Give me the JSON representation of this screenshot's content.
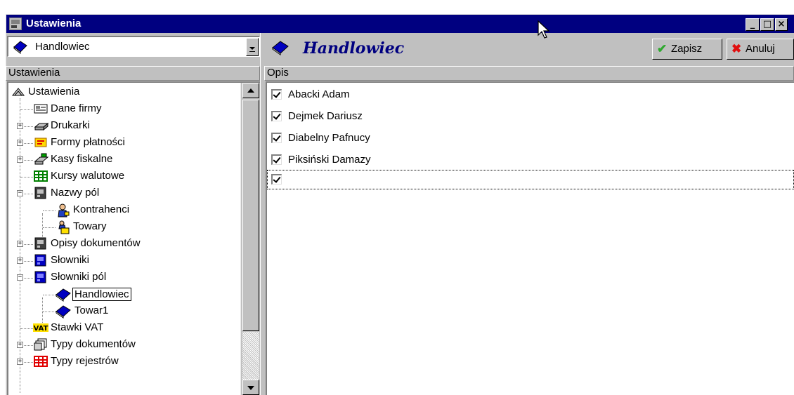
{
  "window": {
    "title": "Ustawienia",
    "minimize": "_",
    "maximize": "□",
    "close": "×"
  },
  "left_panel": {
    "combo_value": "Handlowiec",
    "column_header": "Ustawienia",
    "tree": [
      {
        "label": "Ustawienia",
        "icon": "settings-root-icon",
        "level": 0,
        "expander": ""
      },
      {
        "label": "Dane firmy",
        "icon": "company-card-icon",
        "level": 1,
        "expander": ""
      },
      {
        "label": "Drukarki",
        "icon": "printer-icon",
        "level": 1,
        "expander": "+"
      },
      {
        "label": "Formy płatności",
        "icon": "payment-icon",
        "level": 1,
        "expander": "+"
      },
      {
        "label": "Kasy fiskalne",
        "icon": "cash-register-icon",
        "level": 1,
        "expander": "+"
      },
      {
        "label": "Kursy walutowe",
        "icon": "currency-grid-icon",
        "level": 1,
        "expander": ""
      },
      {
        "label": "Nazwy pól",
        "icon": "field-names-icon",
        "level": 1,
        "expander": "−"
      },
      {
        "label": "Kontrahenci",
        "icon": "contractor-icon",
        "level": 2,
        "expander": ""
      },
      {
        "label": "Towary",
        "icon": "goods-icon",
        "level": 2,
        "expander": ""
      },
      {
        "label": "Opisy dokumentów",
        "icon": "document-desc-icon",
        "level": 1,
        "expander": "+"
      },
      {
        "label": "Słowniki",
        "icon": "dictionary-icon",
        "level": 1,
        "expander": "+"
      },
      {
        "label": "Słowniki pól",
        "icon": "field-dictionary-icon",
        "level": 1,
        "expander": "−"
      },
      {
        "label": "Handlowiec",
        "icon": "book-icon",
        "level": 2,
        "expander": "",
        "selected": true
      },
      {
        "label": "Towar1",
        "icon": "book-icon",
        "level": 2,
        "expander": ""
      },
      {
        "label": "Stawki VAT",
        "icon": "vat-icon",
        "level": 1,
        "expander": ""
      },
      {
        "label": "Typy dokumentów",
        "icon": "document-types-icon",
        "level": 1,
        "expander": "+"
      },
      {
        "label": "Typy rejestrów",
        "icon": "register-types-icon",
        "level": 1,
        "expander": "+"
      }
    ]
  },
  "right_panel": {
    "heading": "Handlowiec",
    "save_label": "Zapisz",
    "cancel_label": "Anuluj",
    "column_header": "Opis",
    "items": [
      {
        "label": "Abacki Adam",
        "checked": true
      },
      {
        "label": "Dejmek Dariusz",
        "checked": true
      },
      {
        "label": "Diabelny Pafnucy",
        "checked": true
      },
      {
        "label": "Piksiński Damazy",
        "checked": true
      },
      {
        "label": "",
        "checked": true,
        "focused": true
      }
    ]
  },
  "colors": {
    "titlebar": "#000080",
    "face": "#c0c0c0",
    "accent_text": "#000080",
    "save_icon": "#2ea82e",
    "cancel_icon": "#e01010"
  }
}
